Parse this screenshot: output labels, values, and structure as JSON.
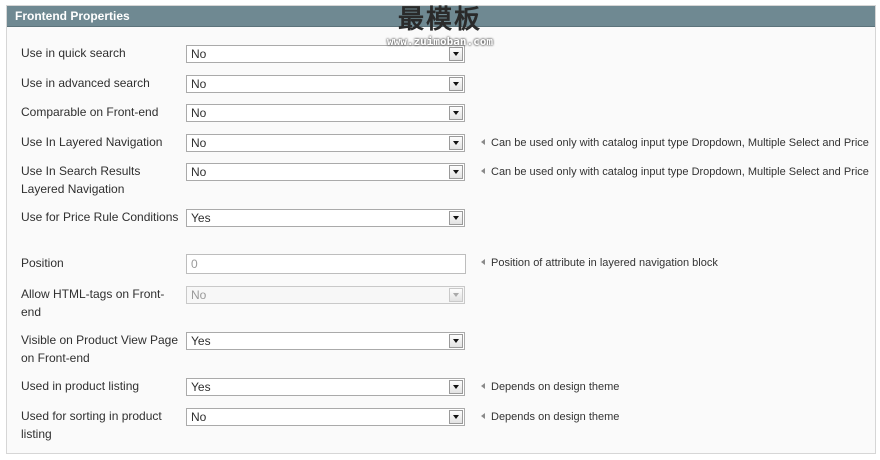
{
  "fieldset": {
    "title": "Frontend Properties"
  },
  "watermark": {
    "title": "最模板",
    "url": "www.zuimoban.com"
  },
  "rows": [
    {
      "label": "Use in quick search",
      "value": "No"
    },
    {
      "label": "Use in advanced search",
      "value": "No"
    },
    {
      "label": "Comparable on Front-end",
      "value": "No"
    },
    {
      "label": "Use In Layered Navigation",
      "value": "No",
      "note": "Can be used only with catalog input type Dropdown, Multiple Select and Price"
    },
    {
      "label": "Use In Search Results Layered Navigation",
      "value": "No",
      "note": "Can be used only with catalog input type Dropdown, Multiple Select and Price"
    },
    {
      "label": "Use for Price Rule Conditions",
      "value": "Yes"
    },
    {
      "label": "Position",
      "value": "0",
      "note": "Position of attribute in layered navigation block"
    },
    {
      "label": "Allow HTML-tags on Front-end",
      "value": "No",
      "disabled": true
    },
    {
      "label": "Visible on Product View Page on Front-end",
      "value": "Yes"
    },
    {
      "label": "Used in product listing",
      "value": "Yes",
      "note": "Depends on design theme"
    },
    {
      "label": "Used for sorting in product listing",
      "value": "No",
      "note": "Depends on design theme"
    }
  ]
}
